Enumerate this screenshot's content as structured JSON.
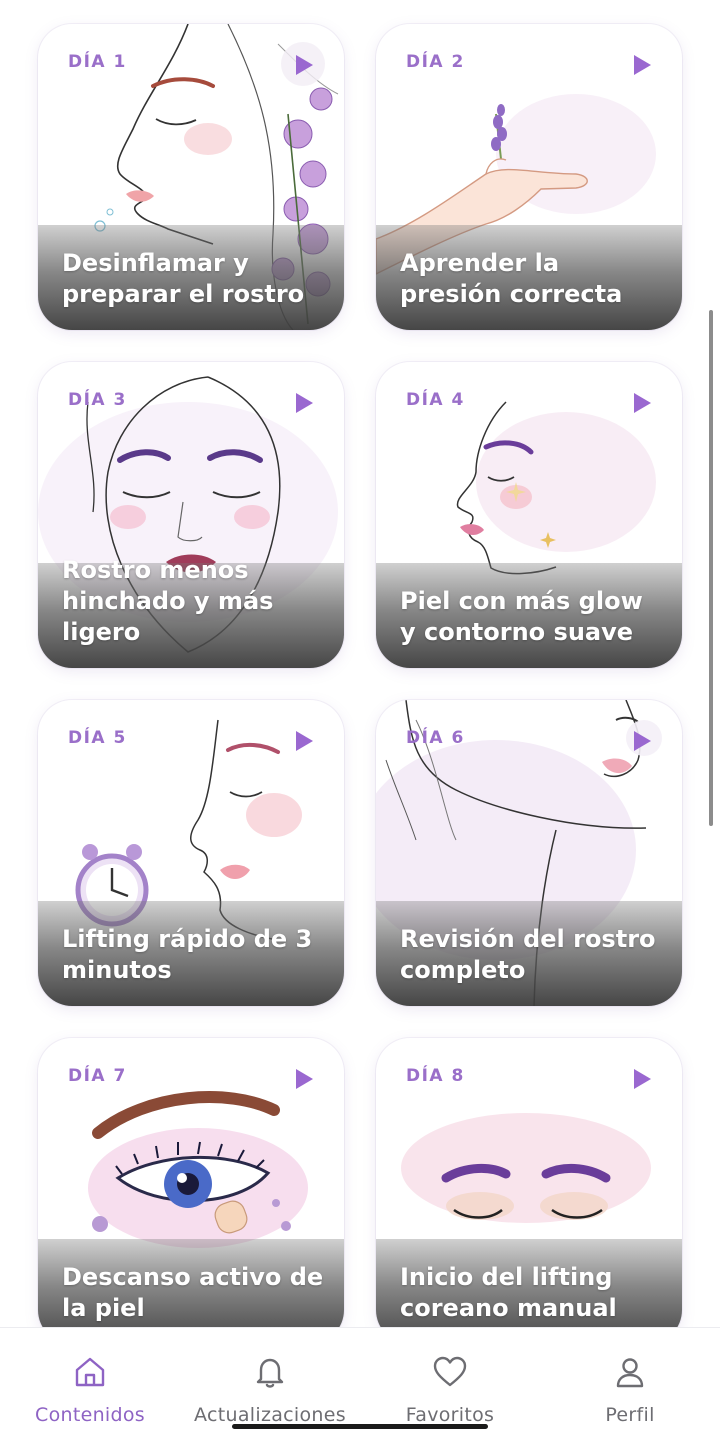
{
  "cards": [
    {
      "day": "DÍA 1",
      "title": "Desinflamar y preparar el rostro"
    },
    {
      "day": "DÍA 2",
      "title": "Aprender la presión correcta"
    },
    {
      "day": "DÍA 3",
      "title": "Rostro menos hinchado y más ligero"
    },
    {
      "day": "DÍA 4",
      "title": "Piel con más glow y contorno suave"
    },
    {
      "day": "DÍA 5",
      "title": "Lifting rápido de 3 minutos"
    },
    {
      "day": "DÍA 6",
      "title": "Revisión del rostro completo"
    },
    {
      "day": "DÍA 7",
      "title": "Descanso activo de la piel"
    },
    {
      "day": "DÍA 8",
      "title": "Inicio del lifting coreano manual"
    }
  ],
  "tabs": [
    {
      "label": "Contenidos",
      "icon": "home-icon",
      "active": true
    },
    {
      "label": "Actualizaciones",
      "icon": "bell-icon",
      "active": false
    },
    {
      "label": "Favoritos",
      "icon": "heart-icon",
      "active": false
    },
    {
      "label": "Perfil",
      "icon": "user-icon",
      "active": false
    }
  ],
  "colors": {
    "accent": "#8e63c4",
    "day_label": "#9a6fc9",
    "play": "#9a68d0",
    "tab_inactive": "#6d6d72"
  }
}
